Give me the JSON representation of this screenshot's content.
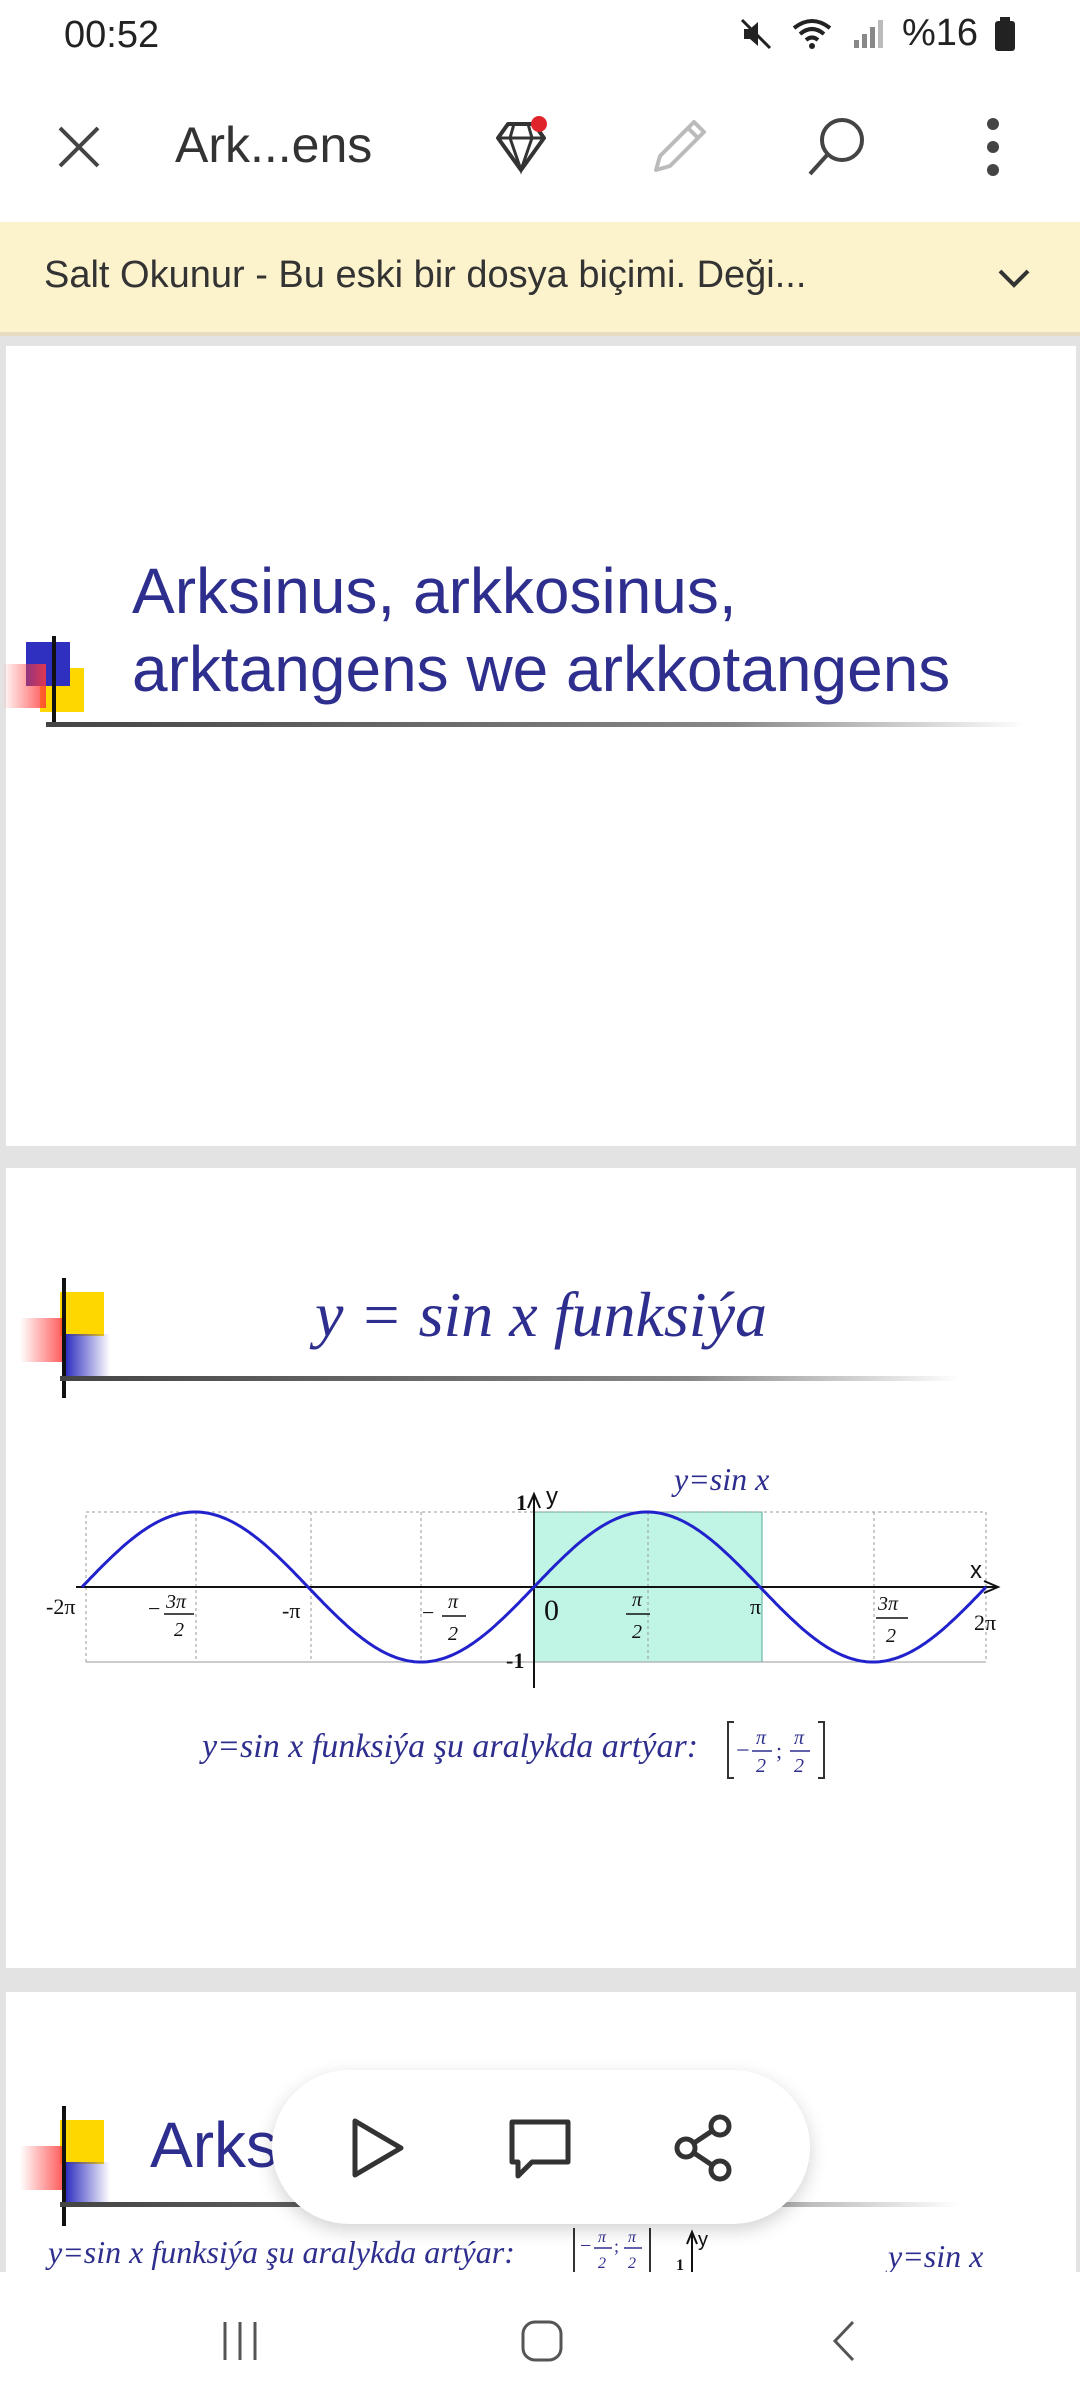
{
  "status_bar": {
    "time": "00:52",
    "battery": "%16"
  },
  "app_bar": {
    "title": "Ark...ens"
  },
  "banner": {
    "text": "Salt Okunur - Bu eski bir dosya biçimi. Deği..."
  },
  "slides": [
    {
      "title_line1": "Arksinus, arkkosinus,",
      "title_line2": "arktangens we arkkotangens"
    },
    {
      "title": "y = sin x    funksiýa",
      "graph": {
        "curve_label": "y=sin x",
        "axis_x": "x",
        "axis_y": "y",
        "y_one": "1",
        "y_minus_one": "-1",
        "origin": "0",
        "x_labels": {
          "m2pi": "-2π",
          "m3pi2_num": "3π",
          "m3pi2_den": "2",
          "mpi": "-π",
          "mpi2_num": "π",
          "mpi2_den": "2",
          "pi2_num": "π",
          "pi2_den": "2",
          "pi": "π",
          "p3pi2_num": "3π",
          "p3pi2_den": "2",
          "p2pi": "2π"
        },
        "minus": "−"
      },
      "caption": "y=sin x funksiýa şu aralykda artýar:",
      "interval": {
        "left_num": "π",
        "left_den": "2",
        "sep": ";",
        "right_num": "π",
        "right_den": "2"
      }
    },
    {
      "title": "Arks",
      "caption": "y=sin x funksiýa şu aralykda artýar:",
      "curve_label": "y=sin x",
      "y_label": "y",
      "y_one": "1"
    }
  ],
  "icons": [
    "close-icon",
    "premium-diamond-icon",
    "edit-pencil-icon",
    "search-icon",
    "more-vert-icon",
    "chevron-down-icon",
    "play-icon",
    "comment-icon",
    "share-icon",
    "recents-icon",
    "home-icon",
    "back-icon"
  ],
  "colors": {
    "title": "#2e2e8e",
    "curve": "#2222cc",
    "highlight": "#c0f5e6",
    "banner": "#fcf2cb"
  }
}
